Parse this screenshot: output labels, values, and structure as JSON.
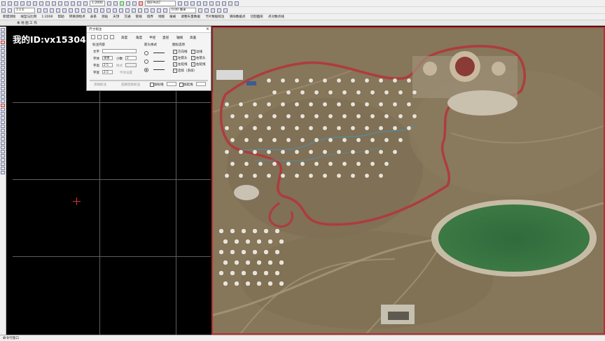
{
  "toolbar": {
    "row1_scale": "1:2000",
    "row1_layer": "DEFAULT",
    "row2_scale": "1:1:E",
    "row2_combo": "0.00 毫米",
    "row3_menu": [
      "新建测绘",
      "线型与比例",
      "1:2000",
      "帮助",
      "转换测绘点",
      "表系",
      "测站",
      "天顶",
      "交通",
      "管线",
      "境界",
      "地貌",
      "植被",
      "调整矢量数据",
      "卡片数据标注",
      "清除数据点",
      "切割图形",
      "点对数点线"
    ],
    "row4_tab": "本 地 图 工 作"
  },
  "watermark": "我的ID:vx153047",
  "dialog": {
    "title": "尺寸标注",
    "close": "×",
    "tabs": [
      "直线",
      "弧线",
      "高度",
      "角度",
      "半径",
      "直径",
      "轴线",
      "高差"
    ],
    "group_content": "标注内容",
    "label_text": "文字",
    "label_font": "字体",
    "font_value": "宋体",
    "label_decimals": "小数",
    "decimals_value": "2",
    "label_height": "字高",
    "height_value": "2.5",
    "label_width": "字宽",
    "width_value": "2.5",
    "label_dim": "样式",
    "btn_font_setting": "字体设置",
    "group_arrow": "箭头样式",
    "group_options": "图标选项",
    "options": [
      {
        "label": "方向线",
        "checked": true
      },
      {
        "label": "左箭头",
        "checked": true
      },
      {
        "label": "左延线",
        "checked": true
      },
      {
        "label": "连续（多段）",
        "checked": true
      }
    ],
    "options_right": [
      {
        "label": "边线",
        "checked": true
      },
      {
        "label": "右箭头",
        "checked": true
      },
      {
        "label": "右延线",
        "checked": true
      }
    ],
    "bottom_left": "添加标注",
    "bottom_mid": "选择连续标注",
    "bottom_check1": "加标线",
    "bottom_check2": "加延线"
  },
  "status": {
    "text": "命令行窗口"
  }
}
